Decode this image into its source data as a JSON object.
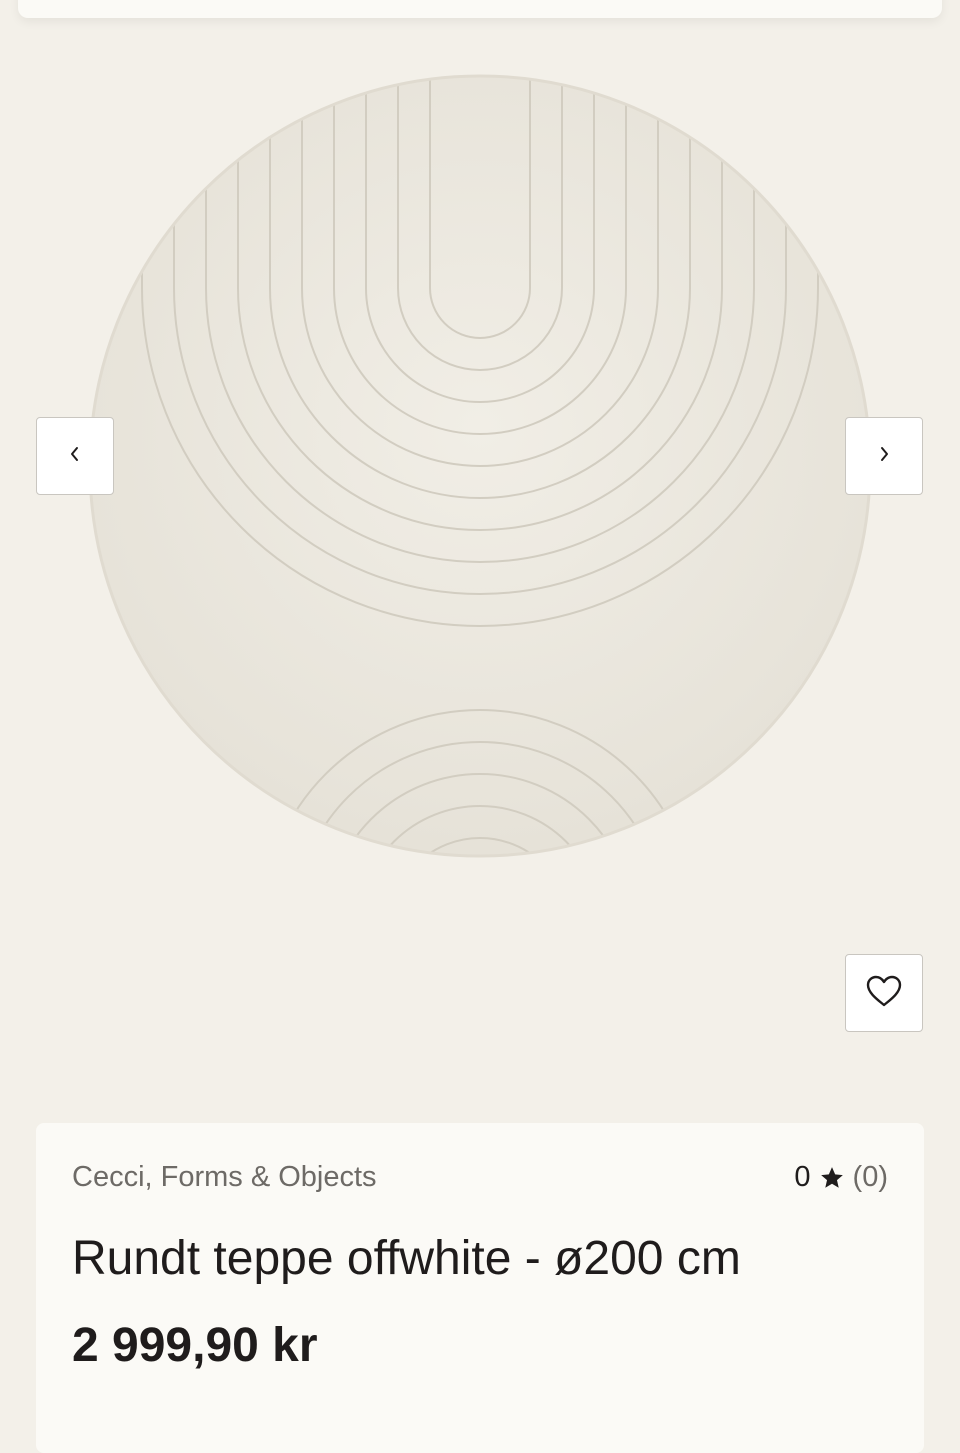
{
  "product": {
    "image_alt": "Rundt teppe offwhite - ø200 cm",
    "brand": "Cecci, Forms & Objects",
    "rating": {
      "score": "0",
      "count": "(0)"
    },
    "title": "Rundt teppe offwhite - ø200 cm",
    "price": "2 999,90 kr"
  },
  "icons": {
    "prev": "chevron-left-icon",
    "next": "chevron-right-icon",
    "favorite": "heart-icon",
    "rating": "star-icon"
  },
  "colors": {
    "page_background": "#f3f0e9",
    "card_background": "#fbfaf6",
    "text_primary": "#1f1c1c",
    "text_secondary": "#6d6a66",
    "rug": "#ece9e0"
  }
}
